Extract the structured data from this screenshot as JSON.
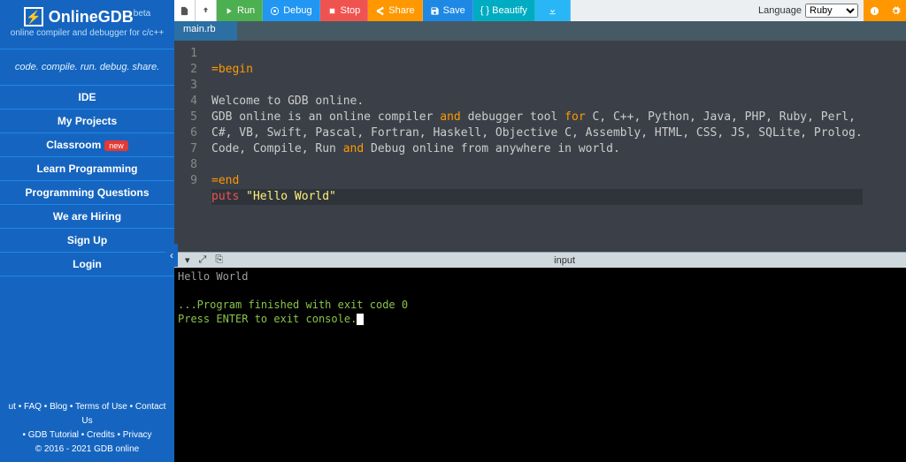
{
  "brand": {
    "name": "OnlineGDB",
    "beta": "beta",
    "tagline": "online compiler and debugger for c/c++",
    "slogan": "code. compile. run. debug. share."
  },
  "nav": {
    "ide": "IDE",
    "projects": "My Projects",
    "classroom": "Classroom",
    "classroom_badge": "new",
    "learn": "Learn Programming",
    "questions": "Programming Questions",
    "hiring": "We are Hiring",
    "signup": "Sign Up",
    "login": "Login"
  },
  "footer": {
    "line1": "ut • FAQ • Blog • Terms of Use • Contact Us",
    "line2": "• GDB Tutorial • Credits • Privacy",
    "copyright": "© 2016 - 2021 GDB online"
  },
  "toolbar": {
    "run": "Run",
    "debug": "Debug",
    "stop": "Stop",
    "share": "Share",
    "save": "Save",
    "beautify": "{ } Beautify",
    "language_label": "Language",
    "language_value": "Ruby"
  },
  "tabs": {
    "active": "main.rb"
  },
  "editor": {
    "lines": [
      "1",
      "2",
      "3",
      "4",
      "5",
      "6",
      "7",
      "8",
      "9"
    ],
    "l1_a": "=",
    "l1_b": "begin",
    "l3": "Welcome to GDB online.",
    "l4_a": "GDB online is an online compiler ",
    "l4_b": "and",
    "l4_c": " debugger tool ",
    "l4_d": "for",
    "l4_e": " C, C++, Python, Java, PHP, Ruby, Perl,",
    "l5": "C#, VB, Swift, Pascal, Fortran, Haskell, Objective C, Assembly, HTML, CSS, JS, SQLite, Prolog.",
    "l6_a": "Code, Compile, Run ",
    "l6_b": "and",
    "l6_c": " Debug online from anywhere in world.",
    "l8_a": "=",
    "l8_b": "end",
    "l9_a": "puts",
    "l9_b": " \"Hello World\""
  },
  "splitter": {
    "label": "input"
  },
  "console": {
    "out": "Hello World",
    "blank": "",
    "exit": "...Program finished with exit code 0",
    "enter": "Press ENTER to exit console."
  }
}
